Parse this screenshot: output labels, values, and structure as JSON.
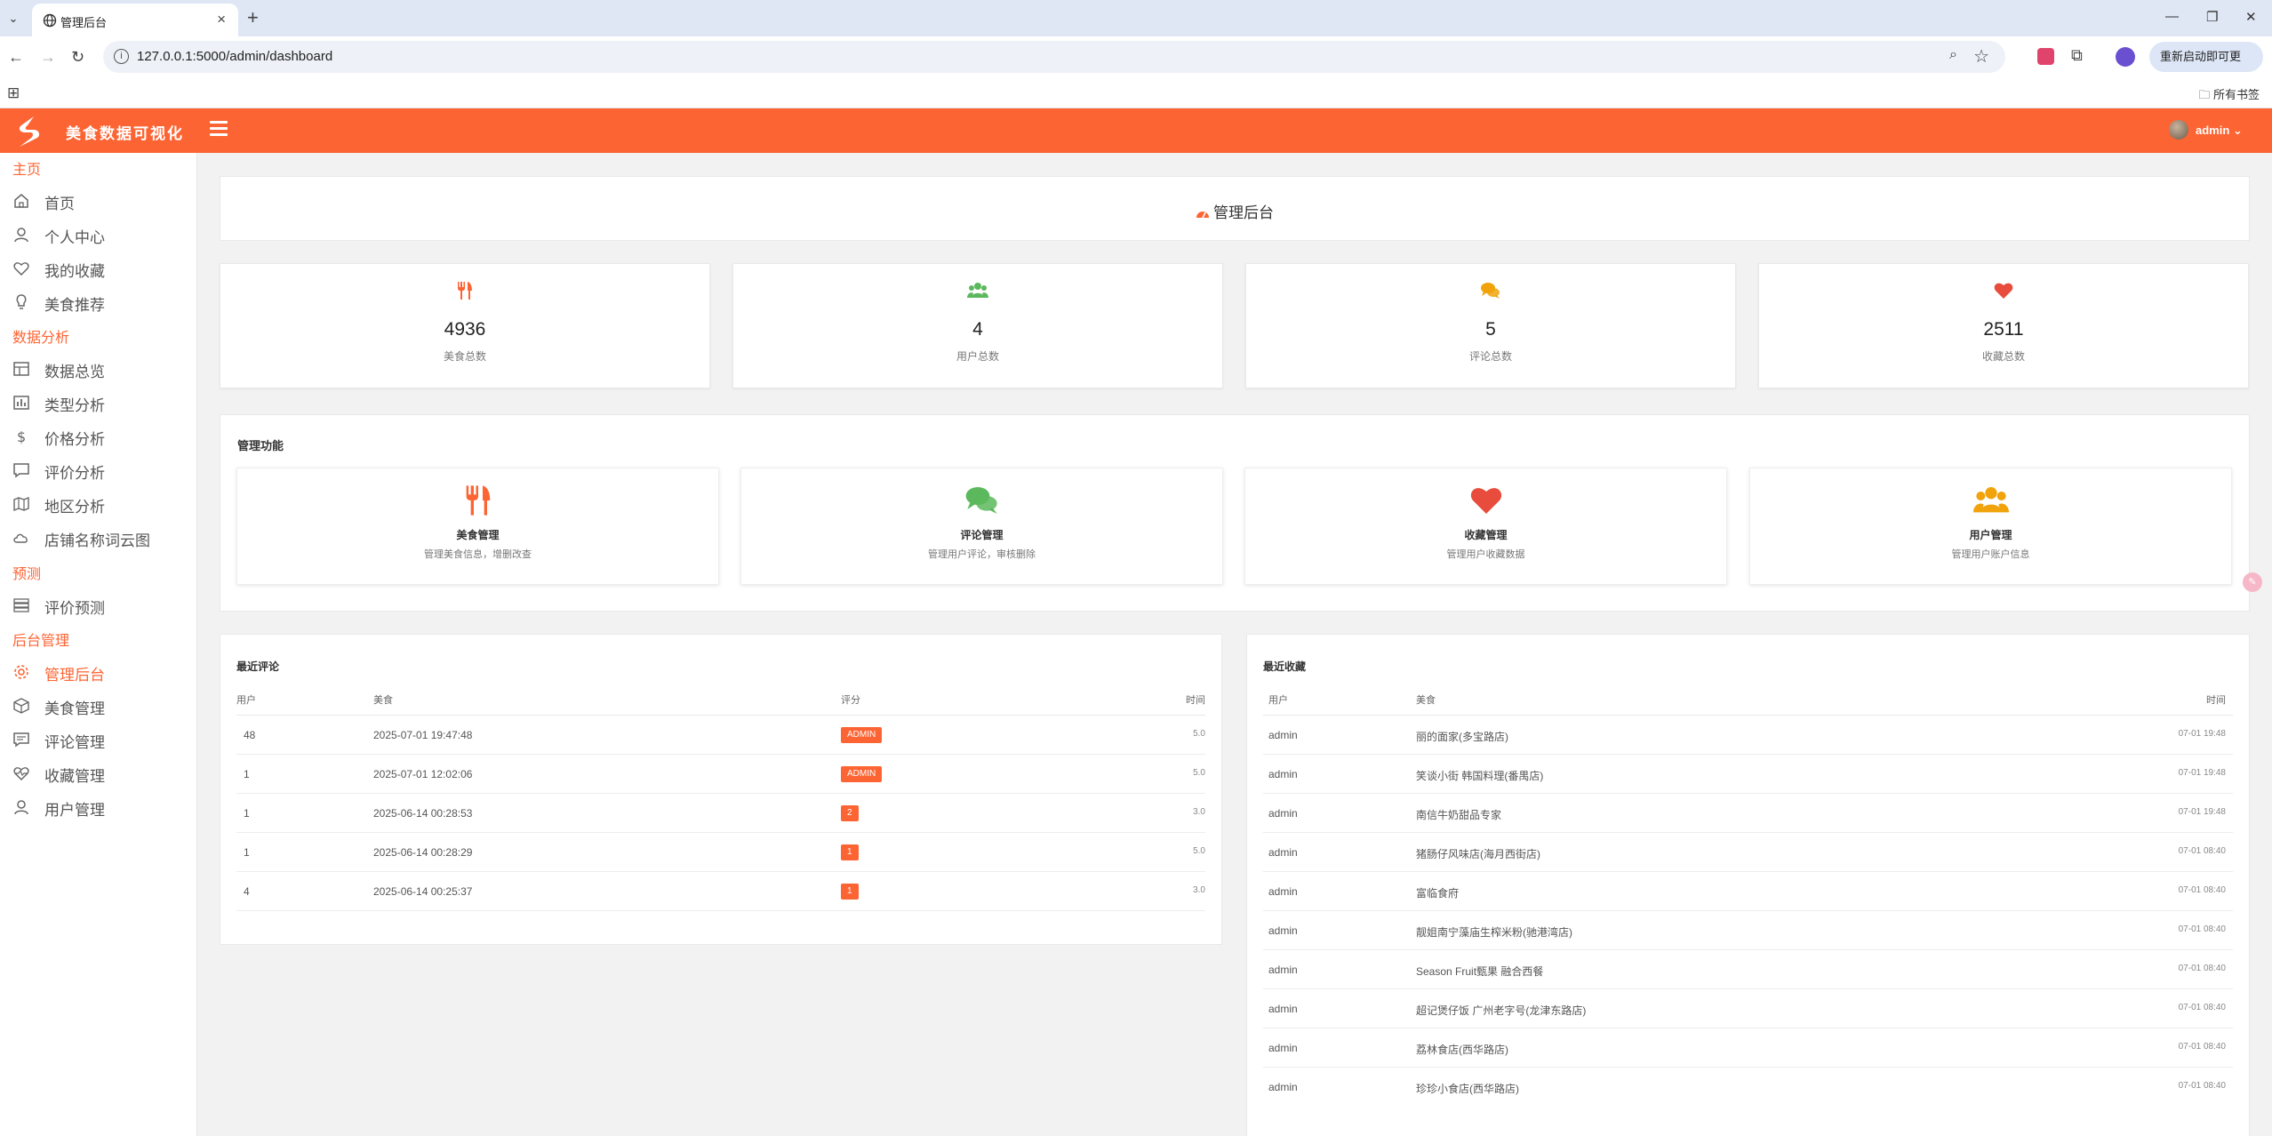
{
  "browser": {
    "tab_title": "管理后台",
    "url": "127.0.0.1:5000/admin/dashboard",
    "update_button": "重新启动即可更新",
    "all_bookmarks": "所有书签"
  },
  "header": {
    "app_title": "美食数据可视化",
    "user": "admin ⌄"
  },
  "sidebar": {
    "sections": [
      "主页",
      "数据分析",
      "预测",
      "后台管理"
    ],
    "items": [
      {
        "label": "首页",
        "icon": "home-icon"
      },
      {
        "label": "个人中心",
        "icon": "user-icon"
      },
      {
        "label": "我的收藏",
        "icon": "heart-icon"
      },
      {
        "label": "美食推荐",
        "icon": "bulb-icon"
      },
      {
        "label": "数据总览",
        "icon": "layout-icon"
      },
      {
        "label": "类型分析",
        "icon": "chart-icon"
      },
      {
        "label": "价格分析",
        "icon": "dollar-icon"
      },
      {
        "label": "评价分析",
        "icon": "comment-icon"
      },
      {
        "label": "地区分析",
        "icon": "map-icon"
      },
      {
        "label": "店铺名称词云图",
        "icon": "cloud-icon"
      },
      {
        "label": "评价预测",
        "icon": "server-icon"
      },
      {
        "label": "管理后台",
        "icon": "gear-icon",
        "active": true
      },
      {
        "label": "美食管理",
        "icon": "box-icon"
      },
      {
        "label": "评论管理",
        "icon": "message-icon"
      },
      {
        "label": "收藏管理",
        "icon": "heart-pulse-icon"
      },
      {
        "label": "用户管理",
        "icon": "user-icon"
      }
    ]
  },
  "page": {
    "title": "管理后台"
  },
  "stats": [
    {
      "value": "4936",
      "label": "美食总数",
      "icon": "utensils-icon",
      "color": "#fd6433"
    },
    {
      "value": "4",
      "label": "用户总数",
      "icon": "users-icon",
      "color": "#5cb85c"
    },
    {
      "value": "5",
      "label": "评论总数",
      "icon": "comments-icon",
      "color": "#f0a30a"
    },
    {
      "value": "2511",
      "label": "收藏总数",
      "icon": "heart-icon",
      "color": "#e74c3c"
    }
  ],
  "functions": {
    "title": "管理功能",
    "cards": [
      {
        "name": "美食管理",
        "desc": "管理美食信息，增删改查",
        "icon": "utensils-icon",
        "color": "#fd6433"
      },
      {
        "name": "评论管理",
        "desc": "管理用户评论，审核删除",
        "icon": "comments-icon",
        "color": "#5cb85c"
      },
      {
        "name": "收藏管理",
        "desc": "管理用户收藏数据",
        "icon": "heart-icon",
        "color": "#e74c3c"
      },
      {
        "name": "用户管理",
        "desc": "管理用户账户信息",
        "icon": "users-icon",
        "color": "#f0a30a"
      }
    ]
  },
  "recent_comments": {
    "title": "最近评论",
    "columns": [
      "用户",
      "美食",
      "评分",
      "时间"
    ],
    "rows": [
      {
        "user": "48",
        "food": "2025-07-01 19:47:48",
        "rating": "ADMIN",
        "time": "5.0"
      },
      {
        "user": "1",
        "food": "2025-07-01 12:02:06",
        "rating": "ADMIN",
        "time": "5.0"
      },
      {
        "user": "1",
        "food": "2025-06-14 00:28:53",
        "rating": "2",
        "time": "3.0"
      },
      {
        "user": "1",
        "food": "2025-06-14 00:28:29",
        "rating": "1",
        "time": "5.0"
      },
      {
        "user": "4",
        "food": "2025-06-14 00:25:37",
        "rating": "1",
        "time": "3.0"
      }
    ]
  },
  "recent_favorites": {
    "title": "最近收藏",
    "columns": [
      "用户",
      "美食",
      "时间"
    ],
    "rows": [
      {
        "user": "admin",
        "food": "丽的面家(多宝路店)",
        "time": "07-01 19:48"
      },
      {
        "user": "admin",
        "food": "笑谈小街 韩国料理(番禺店)",
        "time": "07-01 19:48"
      },
      {
        "user": "admin",
        "food": "南信牛奶甜品专家",
        "time": "07-01 19:48"
      },
      {
        "user": "admin",
        "food": "猪肠仔风味店(海月西街店)",
        "time": "07-01 08:40"
      },
      {
        "user": "admin",
        "food": "富临食府",
        "time": "07-01 08:40"
      },
      {
        "user": "admin",
        "food": "靓姐南宁藻庙生榨米粉(驰港湾店)",
        "time": "07-01 08:40"
      },
      {
        "user": "admin",
        "food": "Season Fruit甄果 融合西餐",
        "time": "07-01 08:40"
      },
      {
        "user": "admin",
        "food": "超记煲仔饭 广州老字号(龙津东路店)",
        "time": "07-01 08:40"
      },
      {
        "user": "admin",
        "food": "荔林食店(西华路店)",
        "time": "07-01 08:40"
      },
      {
        "user": "admin",
        "food": "珍珍小食店(西华路店)",
        "time": "07-01 08:40"
      }
    ]
  }
}
